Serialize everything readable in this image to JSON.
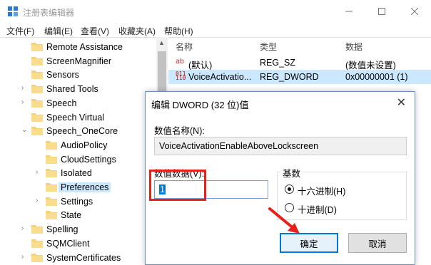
{
  "window": {
    "title": "注册表编辑器"
  },
  "menu": [
    "文件(F)",
    "编辑(E)",
    "查看(V)",
    "收藏夹(A)",
    "帮助(H)"
  ],
  "tree": [
    {
      "label": "Remote Assistance",
      "indent": 0,
      "exp": ""
    },
    {
      "label": "ScreenMagnifier",
      "indent": 0,
      "exp": ""
    },
    {
      "label": "Sensors",
      "indent": 0,
      "exp": ""
    },
    {
      "label": "Shared Tools",
      "indent": 0,
      "exp": ">"
    },
    {
      "label": "Speech",
      "indent": 0,
      "exp": ">"
    },
    {
      "label": "Speech Virtual",
      "indent": 0,
      "exp": ""
    },
    {
      "label": "Speech_OneCore",
      "indent": 0,
      "exp": "v"
    },
    {
      "label": "AudioPolicy",
      "indent": 1,
      "exp": ""
    },
    {
      "label": "CloudSettings",
      "indent": 1,
      "exp": ""
    },
    {
      "label": "Isolated",
      "indent": 1,
      "exp": ">"
    },
    {
      "label": "Preferences",
      "indent": 1,
      "exp": "",
      "selected": true
    },
    {
      "label": "Settings",
      "indent": 1,
      "exp": ">"
    },
    {
      "label": "State",
      "indent": 1,
      "exp": ""
    },
    {
      "label": "Spelling",
      "indent": 0,
      "exp": ">"
    },
    {
      "label": "SQMClient",
      "indent": 0,
      "exp": ""
    },
    {
      "label": "SystemCertificates",
      "indent": 0,
      "exp": ">"
    }
  ],
  "values_header": {
    "name": "名称",
    "type": "类型",
    "data": "数据"
  },
  "values": [
    {
      "icon": "ab",
      "name": "(默认)",
      "type": "REG_SZ",
      "data": "(数值未设置)"
    },
    {
      "icon": "010",
      "name": "VoiceActivatio...",
      "type": "REG_DWORD",
      "data": "0x00000001 (1)",
      "selected": true
    }
  ],
  "dialog": {
    "title": "编辑 DWORD (32 位)值",
    "name_label": "数值名称(N):",
    "name_value": "VoiceActivationEnableAboveLockscreen",
    "data_label": "数值数据(V):",
    "data_value": "1",
    "base_label": "基数",
    "hex_label": "十六进制(H)",
    "dec_label": "十进制(D)",
    "base_selected": "hex",
    "ok_label": "确定",
    "cancel_label": "取消"
  },
  "colors": {
    "annotation": "#e8201a",
    "selection": "#cce8ff",
    "accent": "#0078d7"
  }
}
